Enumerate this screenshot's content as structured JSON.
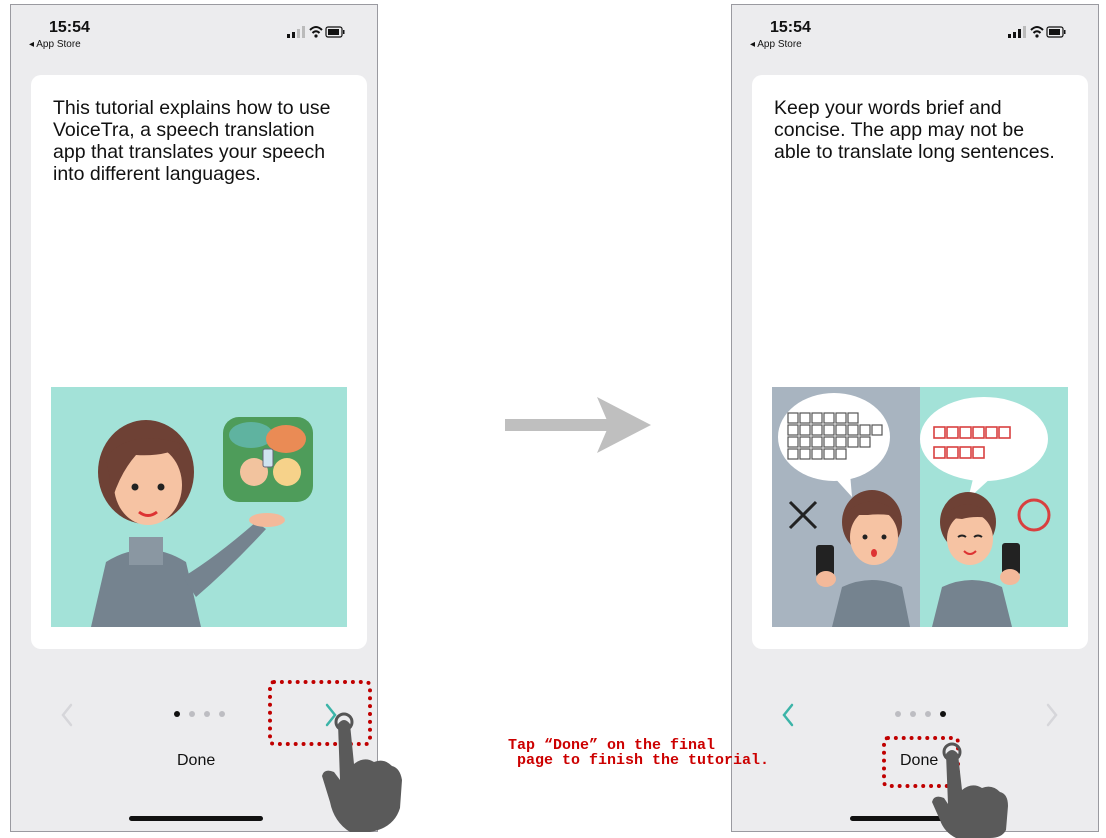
{
  "left_screen": {
    "status": {
      "time": "15:54",
      "back_label": "◂ App Store"
    },
    "card": {
      "text": "This tutorial explains how to use VoiceTra, a speech translation app that translates your speech into different languages."
    },
    "pager": {
      "total": 4,
      "current": 1
    },
    "done_label": "Done"
  },
  "right_screen": {
    "status": {
      "time": "15:54",
      "back_label": "◂ App Store"
    },
    "card": {
      "text": "Keep your words brief and concise. The app may not be able to translate long sentences."
    },
    "pager": {
      "total": 4,
      "current": 4
    },
    "done_label": "Done"
  },
  "annotation": {
    "instruction_line1": "Tap “Done” on the final",
    "instruction_line2": " page to finish the tutorial."
  },
  "colors": {
    "accent": "#3cb4a8",
    "highlight": "#c00000",
    "annotation_text": "#cc0000",
    "illustration_bg": "#a3e2d8",
    "illustration_gray": "#a8b4c0"
  }
}
